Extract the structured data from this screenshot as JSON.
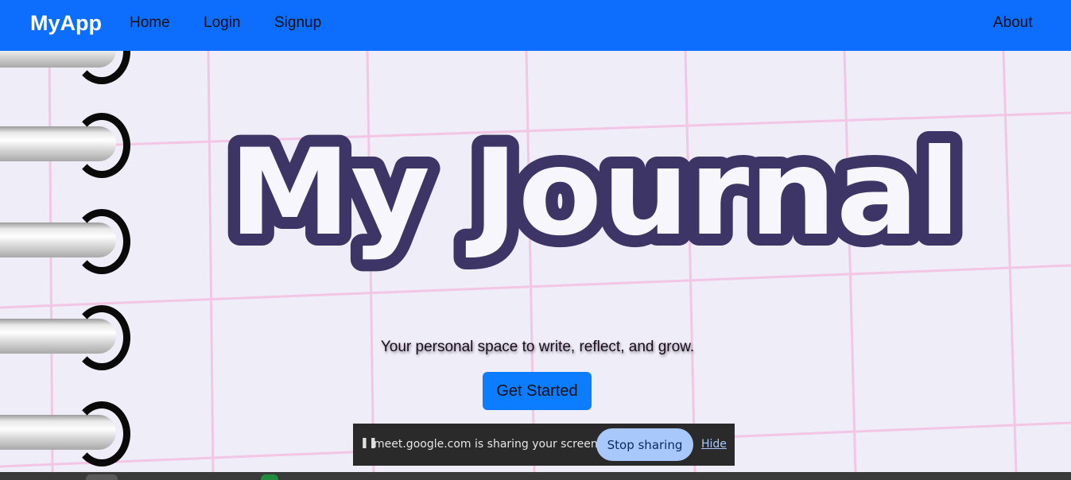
{
  "navbar": {
    "brand": "MyApp",
    "links": [
      "Home",
      "Login",
      "Signup"
    ],
    "about": "About",
    "bg_color": "#0d6efd"
  },
  "hero": {
    "title": "My Journal",
    "tagline": "Your personal space to write, reflect, and grow.",
    "cta_label": "Get Started"
  },
  "screen_share": {
    "pause_icon": "pause-icon",
    "message": "meet.google.com is sharing your screen.",
    "stop_label": "Stop sharing",
    "hide_label": "Hide"
  },
  "colors": {
    "title_outline": "#3d3566",
    "title_fill": "#f8f6fd",
    "grid_line": "#f3c6e6",
    "cta_bg": "#0d7dff"
  }
}
